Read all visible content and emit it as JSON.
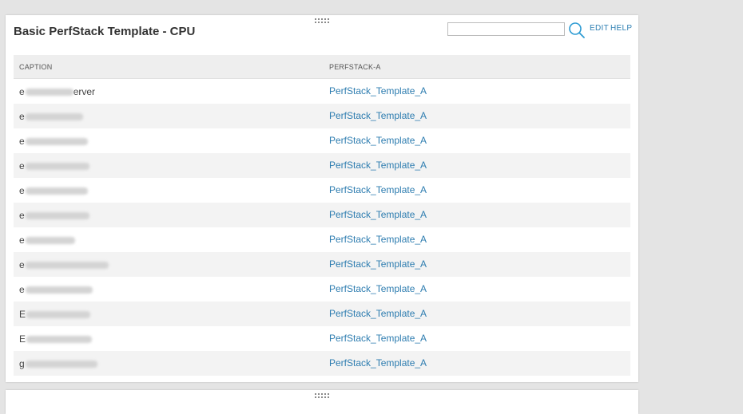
{
  "panel": {
    "title": "Basic PerfStack Template - CPU",
    "search_placeholder": "",
    "edit_label": "EDIT",
    "help_label": "HELP"
  },
  "table": {
    "columns": [
      "CAPTION",
      "PERFSTACK-A"
    ],
    "rows": [
      {
        "caption_visible": "e",
        "caption_tail": "erver",
        "perfstack": "PerfStack_Template_A"
      },
      {
        "caption_visible": "e",
        "caption_tail": "",
        "perfstack": "PerfStack_Template_A"
      },
      {
        "caption_visible": "e",
        "caption_tail": "",
        "perfstack": "PerfStack_Template_A"
      },
      {
        "caption_visible": "e",
        "caption_tail": "",
        "perfstack": "PerfStack_Template_A"
      },
      {
        "caption_visible": "e",
        "caption_tail": "",
        "perfstack": "PerfStack_Template_A"
      },
      {
        "caption_visible": "e",
        "caption_tail": "",
        "perfstack": "PerfStack_Template_A"
      },
      {
        "caption_visible": "e",
        "caption_tail": "",
        "perfstack": "PerfStack_Template_A"
      },
      {
        "caption_visible": "e",
        "caption_tail": "",
        "perfstack": "PerfStack_Template_A"
      },
      {
        "caption_visible": "e",
        "caption_tail": "",
        "perfstack": "PerfStack_Template_A"
      },
      {
        "caption_visible": "E",
        "caption_tail": "",
        "perfstack": "PerfStack_Template_A"
      },
      {
        "caption_visible": "E",
        "caption_tail": "",
        "perfstack": "PerfStack_Template_A"
      },
      {
        "caption_visible": "g",
        "caption_tail": "",
        "perfstack": "PerfStack_Template_A"
      }
    ]
  },
  "colors": {
    "link": "#2e7db0",
    "accent": "#2d7fb3",
    "header_bg": "#eeeeee",
    "page_bg": "#e4e4e4"
  }
}
